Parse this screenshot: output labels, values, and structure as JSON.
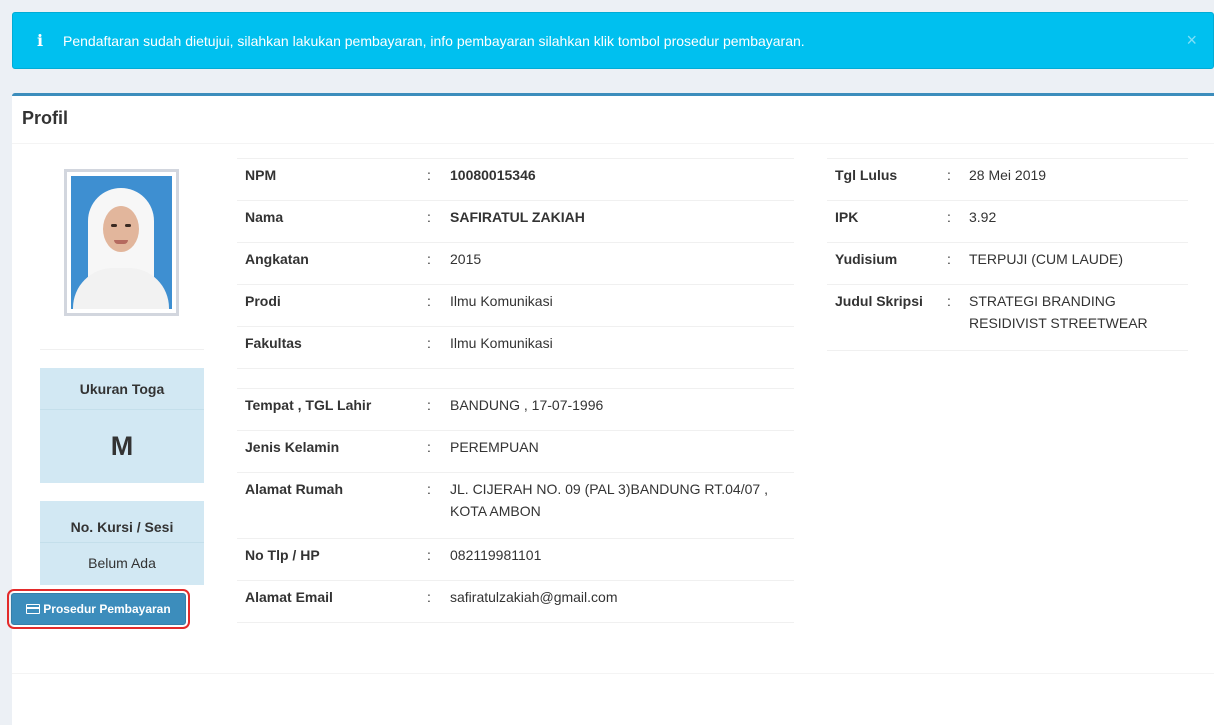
{
  "alert": {
    "message": "Pendaftaran sudah dietujui, silahkan lakukan pembayaran, info pembayaran silahkan klik tombol prosedur pembayaran.",
    "info_glyph": "i",
    "close_glyph": "×",
    "color": "#00c0ef"
  },
  "profile": {
    "title": "Profil",
    "toga": {
      "label": "Ukuran Toga",
      "value": "M"
    },
    "kursi": {
      "label": "No. Kursi / Sesi",
      "value": "Belum Ada"
    },
    "separator": ":",
    "academic": [
      {
        "label": "NPM",
        "value": "10080015346"
      },
      {
        "label": "Nama",
        "value": "SAFIRATUL ZAKIAH"
      },
      {
        "label": "Angkatan",
        "value": "2015"
      },
      {
        "label": "Prodi",
        "value": "Ilmu Komunikasi"
      },
      {
        "label": "Fakultas",
        "value": "Ilmu Komunikasi"
      }
    ],
    "personal": [
      {
        "label": "Tempat , TGL Lahir",
        "value": "BANDUNG , 17-07-1996"
      },
      {
        "label": "Jenis Kelamin",
        "value": "PEREMPUAN"
      },
      {
        "label": "Alamat Rumah",
        "value": "JL. CIJERAH NO. 09 (PAL 3)BANDUNG RT.04/07 , KOTA AMBON"
      },
      {
        "label": "No Tlp / HP",
        "value": "082119981101"
      },
      {
        "label": "Alamat Email",
        "value": "safiratulzakiah@gmail.com"
      }
    ],
    "graduation": [
      {
        "label": "Tgl Lulus",
        "value": "28 Mei 2019"
      },
      {
        "label": "IPK",
        "value": "3.92"
      },
      {
        "label": "Yudisium",
        "value": "TERPUJI (CUM LAUDE)"
      },
      {
        "label": "Judul Skripsi",
        "value": "STRATEGI BRANDING RESIDIVIST STREETWEAR"
      }
    ]
  },
  "actions": {
    "payment_button": "Prosedur Pembayaran",
    "payment_icon": "credit-card-icon",
    "accent": "#3c8dbc"
  }
}
